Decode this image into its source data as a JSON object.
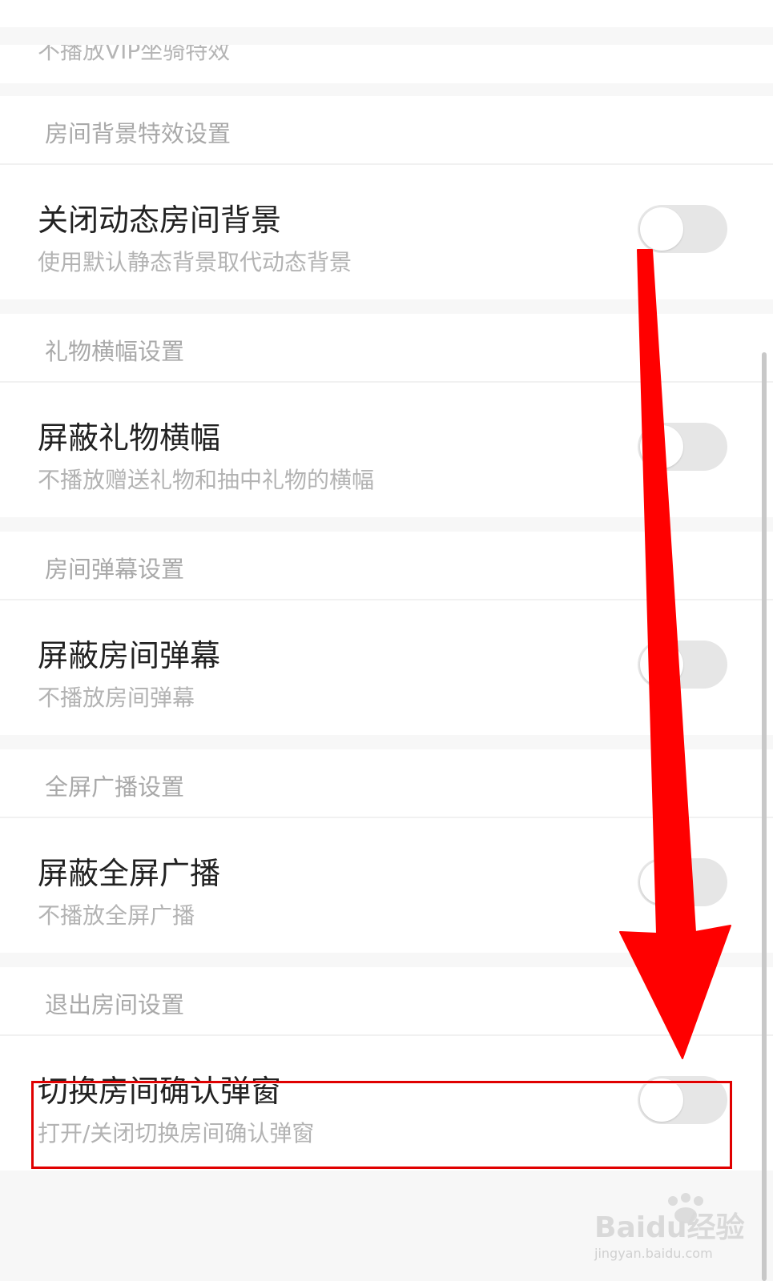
{
  "partial_top_subtitle": "不播放VIP坐骑特效",
  "sections": [
    {
      "header": "房间背景特效设置",
      "item": {
        "title": "关闭动态房间背景",
        "subtitle": "使用默认静态背景取代动态背景",
        "enabled": false
      }
    },
    {
      "header": "礼物横幅设置",
      "item": {
        "title": "屏蔽礼物横幅",
        "subtitle": "不播放赠送礼物和抽中礼物的横幅",
        "enabled": false
      }
    },
    {
      "header": "房间弹幕设置",
      "item": {
        "title": "屏蔽房间弹幕",
        "subtitle": "不播放房间弹幕",
        "enabled": false
      }
    },
    {
      "header": "全屏广播设置",
      "item": {
        "title": "屏蔽全屏广播",
        "subtitle": "不播放全屏广播",
        "enabled": false
      }
    },
    {
      "header": "退出房间设置",
      "item": {
        "title": "切换房间确认弹窗",
        "subtitle": "打开/关闭切换房间确认弹窗",
        "enabled": false
      }
    }
  ],
  "annotation": {
    "arrow_color": "#ff0000",
    "highlight_color": "#e00000"
  },
  "watermark": {
    "main": "Baidu经验",
    "sub": "jingyan.baidu.com"
  },
  "colors": {
    "page_bg": "#f7f7f7",
    "card_bg": "#ffffff",
    "title": "#222222",
    "subtitle": "#b3b3b3",
    "toggle_off": "#e6e6e6"
  }
}
